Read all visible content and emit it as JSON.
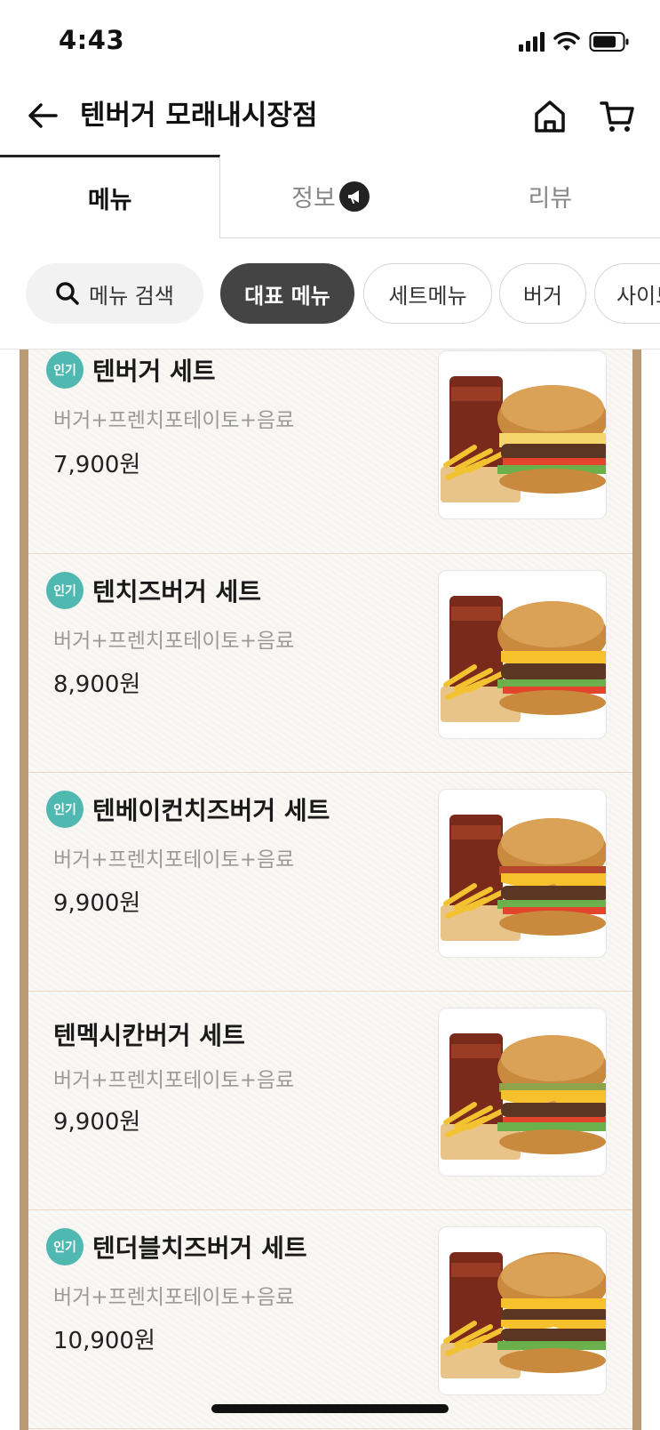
{
  "status": {
    "time": "4:43"
  },
  "header": {
    "title": "텐버거 모래내시장점"
  },
  "tabs": [
    {
      "label": "메뉴"
    },
    {
      "label": "정보"
    },
    {
      "label": "리뷰"
    }
  ],
  "filters": {
    "search_label": "메뉴 검색",
    "chips": [
      "대표 메뉴",
      "세트메뉴",
      "버거",
      "사이드"
    ]
  },
  "colors": {
    "badge": "#4fb8b0",
    "frame": "#b89a74",
    "chip_selected": "#444444"
  },
  "menu_items": [
    {
      "badge": "인기",
      "name": "텐버거 세트",
      "desc": "버거+프렌치포테이토+음료",
      "price": "7,900원",
      "image": "burger-set-image"
    },
    {
      "badge": "인기",
      "name": "텐치즈버거 세트",
      "desc": "버거+프렌치포테이토+음료",
      "price": "8,900원",
      "image": "cheeseburger-set-image"
    },
    {
      "badge": "인기",
      "name": "텐베이컨치즈버거 세트",
      "desc": "버거+프렌치포테이토+음료",
      "price": "9,900원",
      "image": "bacon-cheeseburger-set-image"
    },
    {
      "badge": "",
      "name": "텐멕시칸버거 세트",
      "desc": "버거+프렌치포테이토+음료",
      "price": "9,900원",
      "image": "mexican-burger-set-image"
    },
    {
      "badge": "인기",
      "name": "텐더블치즈버거 세트",
      "desc": "버거+프렌치포테이토+음료",
      "price": "10,900원",
      "image": "double-cheeseburger-set-image"
    }
  ]
}
